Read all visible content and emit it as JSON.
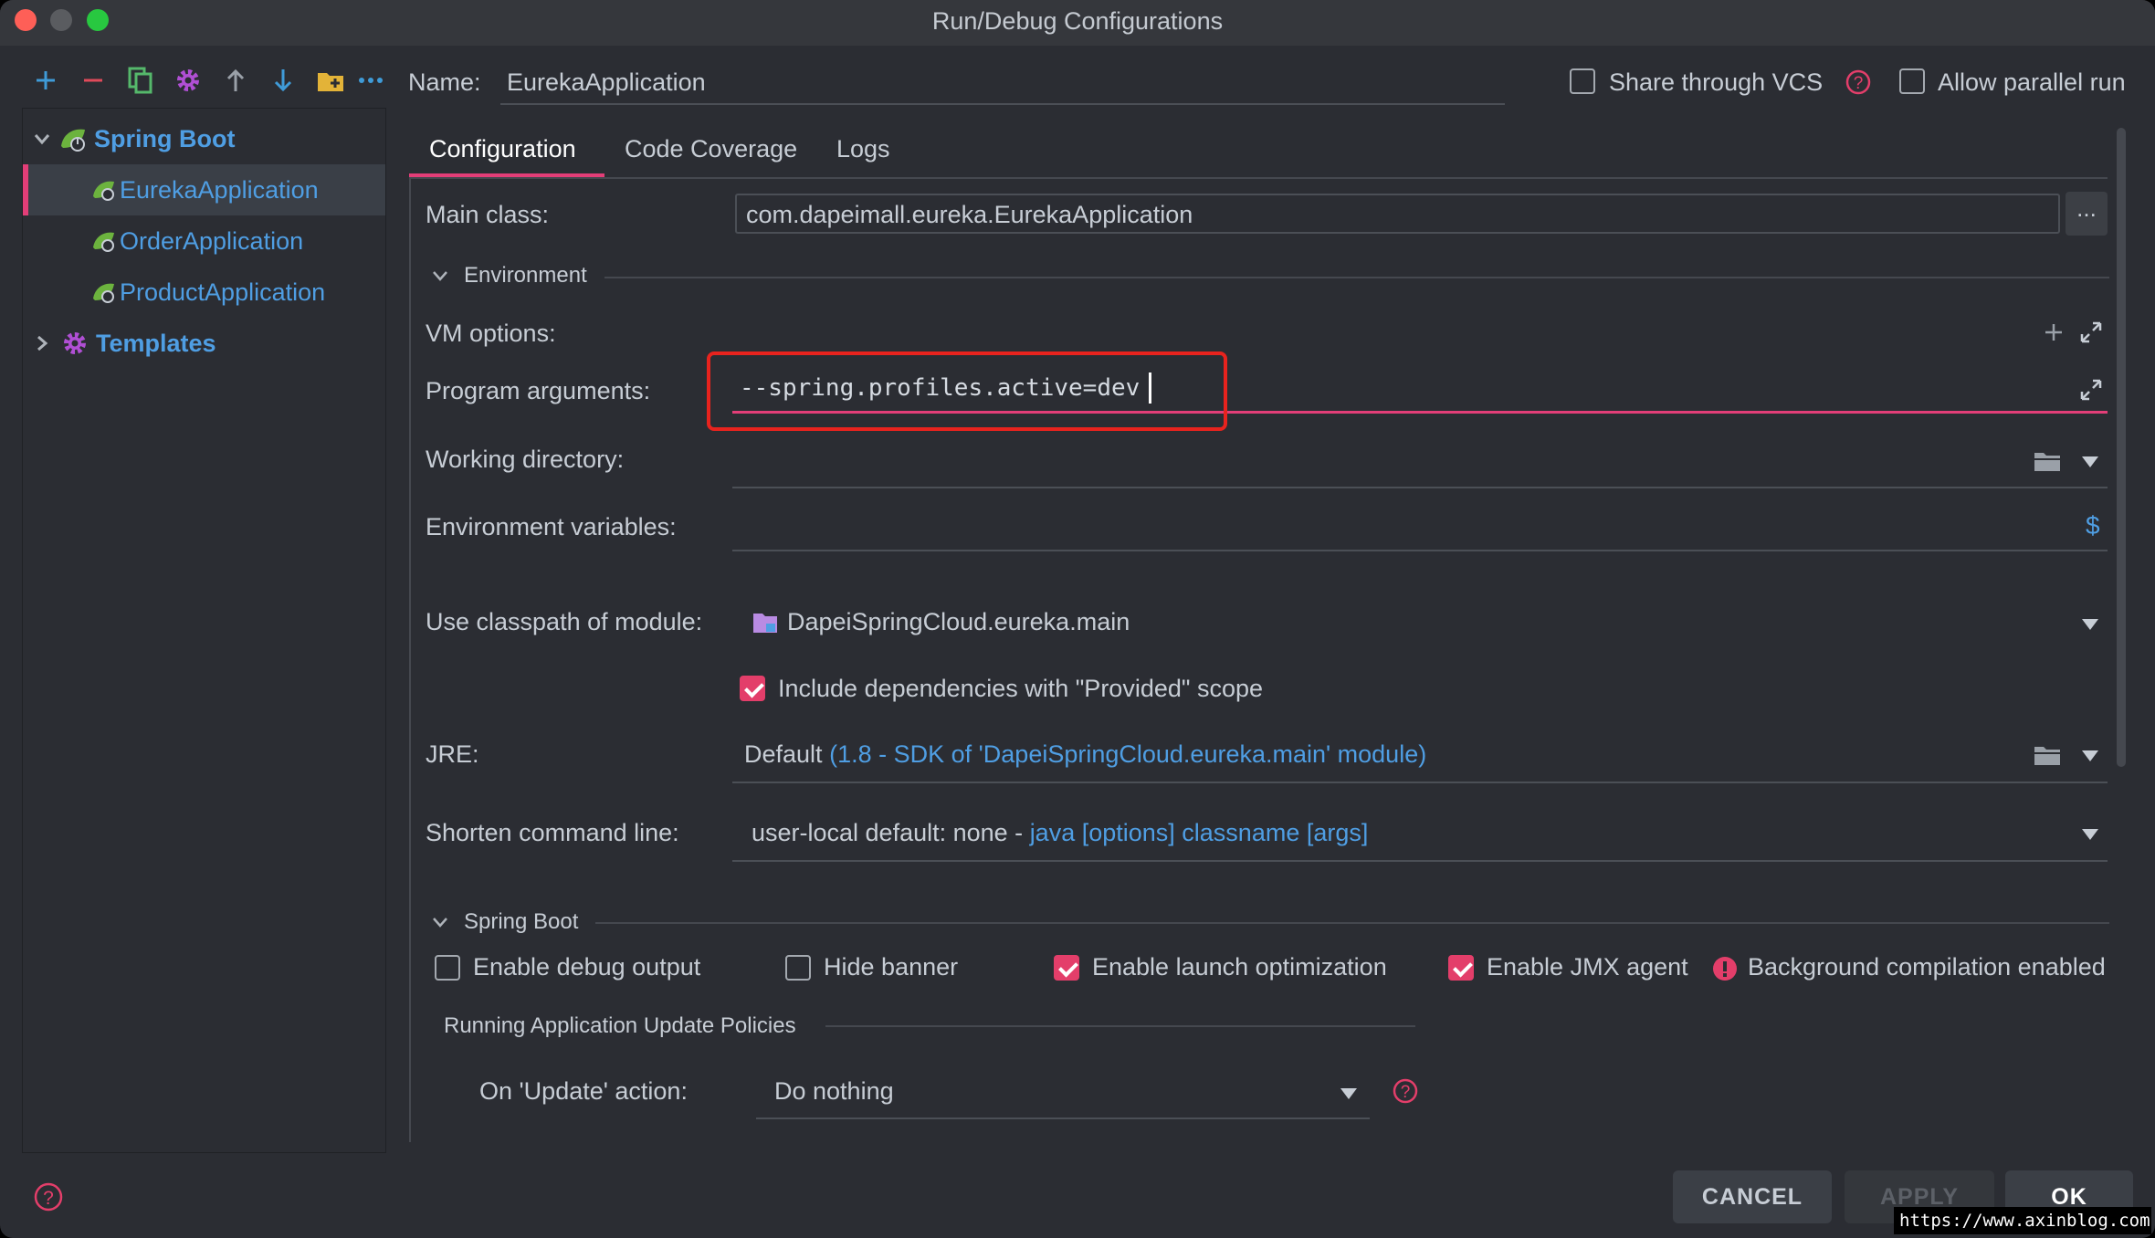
{
  "window": {
    "title": "Run/Debug Configurations"
  },
  "toolbar": {
    "icons": [
      "add-icon",
      "remove-icon",
      "copy-icon",
      "settings-icon",
      "move-up-icon",
      "move-down-icon",
      "new-folder-icon",
      "more-icon"
    ]
  },
  "tree": {
    "groups": [
      {
        "label": "Spring Boot",
        "expanded": true,
        "items": [
          "EurekaApplication",
          "OrderApplication",
          "ProductApplication"
        ]
      },
      {
        "label": "Templates",
        "expanded": false
      }
    ]
  },
  "name": {
    "label": "Name:",
    "value": "EurekaApplication"
  },
  "share_vcs": {
    "label": "Share through VCS",
    "checked": false
  },
  "parallel": {
    "label": "Allow parallel run",
    "checked": false
  },
  "tabs": [
    "Configuration",
    "Code Coverage",
    "Logs"
  ],
  "config": {
    "main_class": {
      "label": "Main class:",
      "value": "com.dapeimall.eureka.EurekaApplication",
      "browse": "..."
    },
    "environment": "Environment",
    "vm_options": {
      "label": "VM options:",
      "value": ""
    },
    "program_args": {
      "label": "Program arguments:",
      "value": "--spring.profiles.active=dev"
    },
    "working_dir": {
      "label": "Working directory:",
      "value": ""
    },
    "env_vars": {
      "label": "Environment variables:",
      "value": "",
      "icon": "$"
    },
    "classpath": {
      "label": "Use classpath of module:",
      "value": "DapeiSpringCloud.eureka.main"
    },
    "include_deps": {
      "label": "Include dependencies with \"Provided\" scope",
      "checked": true
    },
    "jre": {
      "label": "JRE:",
      "value_prefix": "Default",
      "value_detail": "(1.8 - SDK of 'DapeiSpringCloud.eureka.main' module)"
    },
    "shorten": {
      "label": "Shorten command line:",
      "value_prefix": "user-local default: none -",
      "value_detail": "java [options] classname [args]"
    }
  },
  "spring_boot": {
    "section": "Spring Boot",
    "enable_debug": {
      "label": "Enable debug output",
      "checked": false
    },
    "hide_banner": {
      "label": "Hide banner",
      "checked": false
    },
    "launch_opt": {
      "label": "Enable launch optimization",
      "checked": true
    },
    "jmx": {
      "label": "Enable JMX agent",
      "checked": true
    },
    "bg_compile": {
      "label": "Background compilation enabled"
    },
    "policies": "Running Application Update Policies",
    "on_update": {
      "label": "On 'Update' action:",
      "value": "Do nothing"
    }
  },
  "buttons": {
    "cancel": "CANCEL",
    "apply": "APPLY",
    "ok": "OK"
  },
  "watermark": "https://www.axinblog.com",
  "colors": {
    "accent": "#e33e78",
    "link": "#4f9ee3",
    "highlight_box": "#e8231e"
  }
}
